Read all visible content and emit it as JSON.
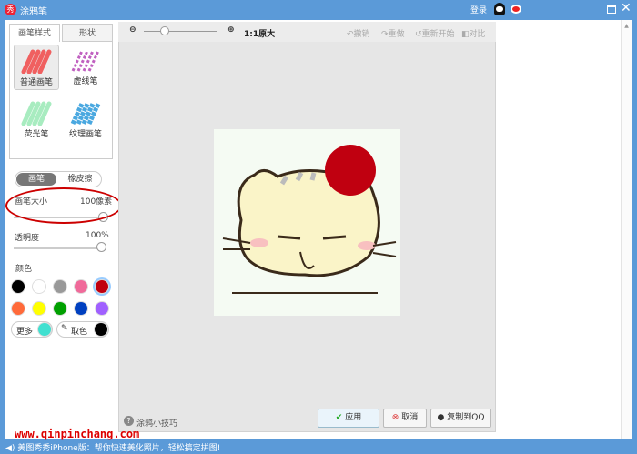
{
  "app": {
    "title": "涂鸦笔",
    "login": "登录",
    "accent": "#5b9ad8"
  },
  "left": {
    "tabs": [
      "画笔样式",
      "形状"
    ],
    "brushes": [
      {
        "label": "普通画笔",
        "color": "#f06060"
      },
      {
        "label": "虚线笔",
        "color": "#c060c0"
      },
      {
        "label": "荧光笔",
        "color": "#a8ecc0"
      },
      {
        "label": "纹理画笔",
        "color": "#4aa8e0"
      }
    ],
    "mode": [
      "画笔",
      "橡皮擦"
    ],
    "size_label": "画笔大小",
    "size_value": "100像素",
    "opacity_label": "透明度",
    "opacity_value": "100%",
    "color_label": "颜色",
    "colors": [
      "#000000",
      "#ffffff",
      "#999999",
      "#f06a9a",
      "#c00010",
      "#ff6a3a",
      "#ffff00",
      "#00a000",
      "#0040c0",
      "#a060ff"
    ],
    "more_label": "更多",
    "more_color": "#40e0d0",
    "picker_label": "取色",
    "picker_color": "#000000"
  },
  "toolbar": {
    "zoom_label": "1:1原大",
    "undo": "撤销",
    "redo": "重做",
    "restart": "重新开始",
    "compare": "对比"
  },
  "footer": {
    "tips": "涂鸦小技巧",
    "apply": "应用",
    "cancel": "取消",
    "copy_qq": "复制到QQ"
  },
  "status": {
    "text": "美图秀秀iPhone版：帮你快速美化照片，轻松搞定拼图!"
  },
  "watermark": "www.qinpinchang.com"
}
